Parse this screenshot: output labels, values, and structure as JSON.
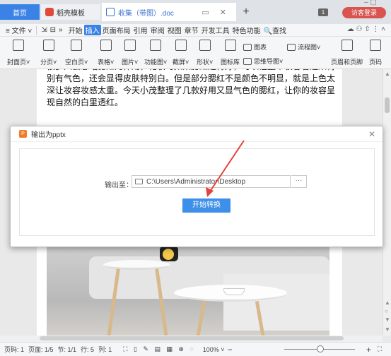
{
  "tabs": {
    "home": "首页",
    "daoke": "稻壳模板",
    "doc": "收集（带图）.doc",
    "add": "+",
    "tab_icons": "▭ ✕"
  },
  "window": {
    "badge": "1",
    "login": "访客登录",
    "controls": "–  ▢"
  },
  "menu": {
    "items": [
      "≡ 文件 ˅",
      "⇲",
      "⊟",
      "»",
      "开始",
      "插入",
      "页面布局",
      "引用",
      "审阅",
      "视图",
      "章节",
      "开发工具",
      "特色功能",
      "🔍查找"
    ],
    "active_index": 5,
    "right_icons": "☁  ⚇  ⇧  ⋮  ˄"
  },
  "ribbon": {
    "cover": "封面页˅",
    "page_break": "分页˅",
    "blank_page": "空白页˅",
    "table": "表格˅",
    "picture": "图片˅",
    "func_img": "功能图˅",
    "screenshot": "截屏˅",
    "shape": "形状˅",
    "icon_lib": "图标库",
    "chart": "图表",
    "mind_map": "思维导图˅",
    "flowchart": "流程图˅",
    "header_footer": "页眉和页脚",
    "page_number": "页码"
  },
  "document": {
    "paragraph": "很多人会忽略腮红的作用，化妆时如果腮红选得好，可以让整个妆容看起来特别有气色，还会显得皮肤特别白。但是部分腮红不是颜色不明显，就是上色太深让妆容妆感太重。今天小茂整理了几款好用又显气色的腮红，让你的妆容呈现自然的白里透红。"
  },
  "dialog": {
    "title": "输出为pptx",
    "logo": "P",
    "close": "✕",
    "output_label": "输出至：",
    "output_path": "C:\\Users\\Administrator\\Desktop",
    "browse": "···",
    "start_button": "开始转换"
  },
  "status": {
    "page_no": "页码: 1",
    "pages": "页面: 1/5",
    "section": "节: 1/1",
    "line": "行: 5",
    "column": "列: 1",
    "view_icons": "⛶ ▯ ✎ ▤ ▦ ⊕ ◌",
    "zoom": "100% ˅",
    "zoom_minus": "−",
    "zoom_plus": "+",
    "fit": "⛶"
  },
  "colors": {
    "accent": "#3b82e6",
    "start_button": "#3e8fe8",
    "login": "#d9534f",
    "arrow": "#e8403a"
  }
}
